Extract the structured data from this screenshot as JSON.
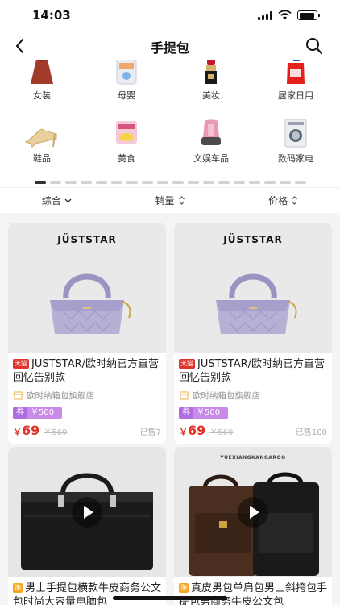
{
  "status": {
    "time": "14:03",
    "battery_level": 0.9
  },
  "nav": {
    "title": "手提包"
  },
  "categories": [
    {
      "label": "女装",
      "icon": "dress-icon"
    },
    {
      "label": "母婴",
      "icon": "baby-formula-icon"
    },
    {
      "label": "美妆",
      "icon": "lipstick-icon"
    },
    {
      "label": "居家日用",
      "icon": "detergent-bottle-icon"
    },
    {
      "label": "鞋品",
      "icon": "heels-icon"
    },
    {
      "label": "美食",
      "icon": "snack-bag-icon"
    },
    {
      "label": "文娱车品",
      "icon": "car-seat-icon"
    },
    {
      "label": "数码家电",
      "icon": "washing-machine-icon"
    }
  ],
  "sort": {
    "comprehensive": "综合",
    "sales": "销量",
    "price": "价格"
  },
  "products": [
    {
      "brand": "JÜSTSTAR",
      "tag": "天猫",
      "title": "JUSTSTAR/欧时纳官方直营 回忆告别款",
      "shop": "欧时纳箱包旗舰店",
      "coupon_label": "券",
      "coupon_value": "￥500",
      "price_symbol": "￥",
      "price": "69",
      "original_price": "￥569",
      "sold": "已售7",
      "has_video": false,
      "accent_color": "#b7b0d4"
    },
    {
      "brand": "JÜSTSTAR",
      "tag": "天猫",
      "title": "JUSTSTAR/欧时纳官方直营 回忆告别款",
      "shop": "欧时纳箱包旗舰店",
      "coupon_label": "券",
      "coupon_value": "￥500",
      "price_symbol": "￥",
      "price": "69",
      "original_price": "￥569",
      "sold": "已售100",
      "has_video": false,
      "accent_color": "#b7b0d4"
    },
    {
      "brand": "",
      "tag": "淘",
      "title": "男士手提包横款牛皮商务公文包时尚大容量电脑包",
      "has_video": true,
      "accent_color": "#1b1b1b"
    },
    {
      "brand": "YUEXIANGKANGAROO",
      "tag": "淘",
      "title": "真皮男包单肩包男士斜挎包手提包男商务牛皮公文包",
      "has_video": true,
      "accent_color": "#3a2418"
    }
  ],
  "colors": {
    "price_red": "#e0332a",
    "coupon_purple": "#b06be0"
  }
}
